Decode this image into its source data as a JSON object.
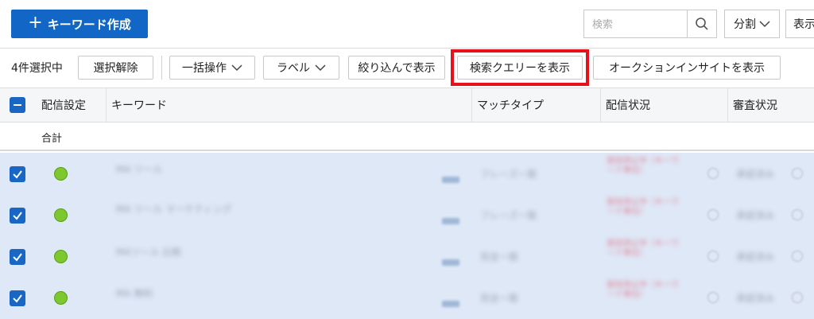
{
  "topbar": {
    "create_button_label": "キーワード作成",
    "search_placeholder": "検索",
    "split_label": "分割",
    "show_label": "表示"
  },
  "toolbar": {
    "selection_text": "4件選択中",
    "deselect_label": "選択解除",
    "bulk_label": "一括操作",
    "label_label": "ラベル",
    "filter_label": "絞り込んで表示",
    "search_query_label": "検索クエリーを表示",
    "auction_label": "オークションインサイトを表示"
  },
  "table": {
    "headers": {
      "delivery_setting": "配信設定",
      "keyword": "キーワード",
      "match_type": "マッチタイプ",
      "delivery_status": "配信状況",
      "review_status": "審査状況"
    },
    "total_label": "合計",
    "rows": [
      {
        "keyword": "MA ツール",
        "match": "フレーズ一致",
        "status_a": "配信停止中（キーワ",
        "status_b": "ード単位）",
        "review": "承認済み"
      },
      {
        "keyword": "MA ツール マーケティング",
        "match": "フレーズ一致",
        "status_a": "配信停止中（キーワ",
        "status_b": "ード単位）",
        "review": "承認済み"
      },
      {
        "keyword": "MAツール 比較",
        "match": "完全一致",
        "status_a": "配信停止中（キーワ",
        "status_b": "ード単位）",
        "review": "承認済み"
      },
      {
        "keyword": "MA 無料",
        "match": "完全一致",
        "status_a": "配信停止中（キーワ",
        "status_b": "ード単位）",
        "review": "承認済み"
      }
    ]
  },
  "colors": {
    "primary": "#1267c6",
    "highlight": "#e8101a",
    "row_selected": "#dfe8f7",
    "status_active": "#7cc82e"
  }
}
